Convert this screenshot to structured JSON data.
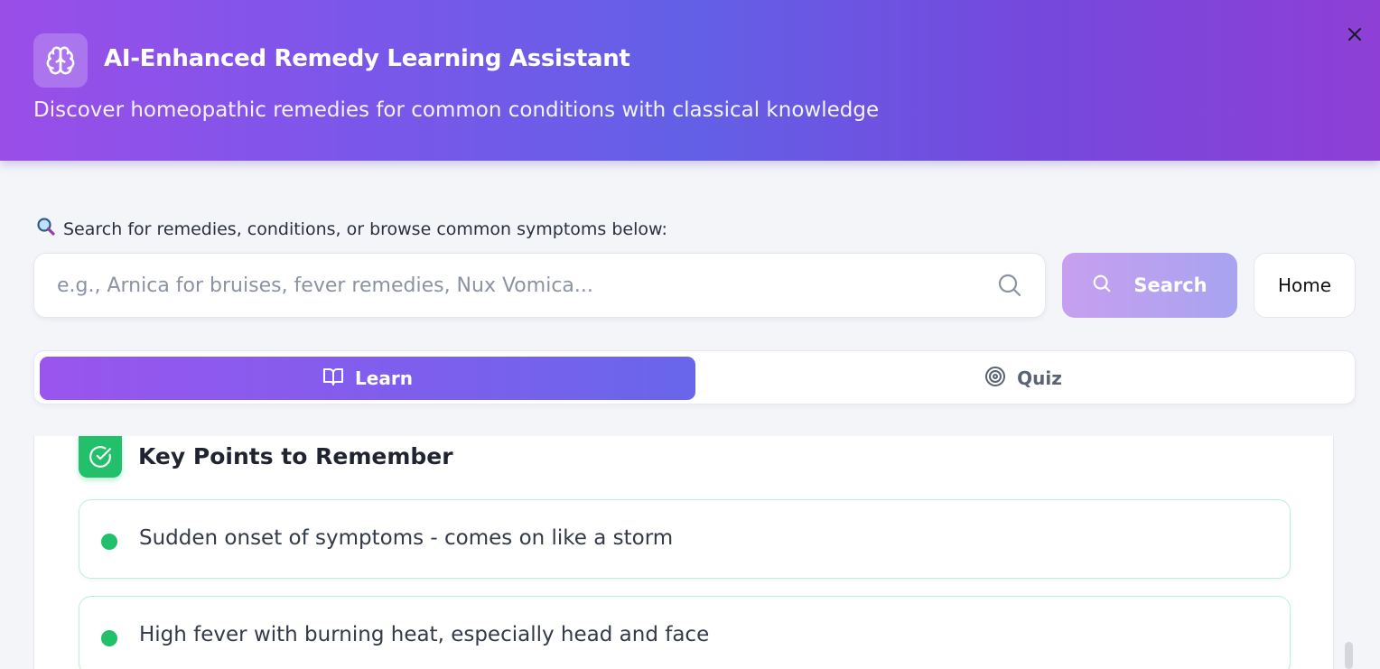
{
  "header": {
    "title": "AI-Enhanced Remedy Learning Assistant",
    "subtitle": "Discover homeopathic remedies for common conditions with classical knowledge",
    "logo_icon": "brain-icon",
    "close_icon": "close-icon"
  },
  "search": {
    "label": "Search for remedies, conditions, or browse common symptoms below:",
    "label_icon": "magnifier-emoji-icon",
    "placeholder": "e.g., Arnica for bruises, fever remedies, Nux Vomica...",
    "value": "",
    "button_label": "Search",
    "home_label": "Home"
  },
  "tabs": [
    {
      "label": "Learn",
      "icon": "book-open-icon",
      "active": true
    },
    {
      "label": "Quiz",
      "icon": "target-icon",
      "active": false
    }
  ],
  "key_points": {
    "title": "Key Points to Remember",
    "icon": "check-circle-icon",
    "items": [
      "Sudden onset of symptoms - comes on like a storm",
      "High fever with burning heat, especially head and face"
    ]
  },
  "colors": {
    "header_gradient_start": "#9a4ee8",
    "header_gradient_mid": "#6360e6",
    "header_gradient_end": "#8e3fd6",
    "accent_green": "#22c06a",
    "tab_active_start": "#9a55ee",
    "tab_active_end": "#6966ec"
  }
}
